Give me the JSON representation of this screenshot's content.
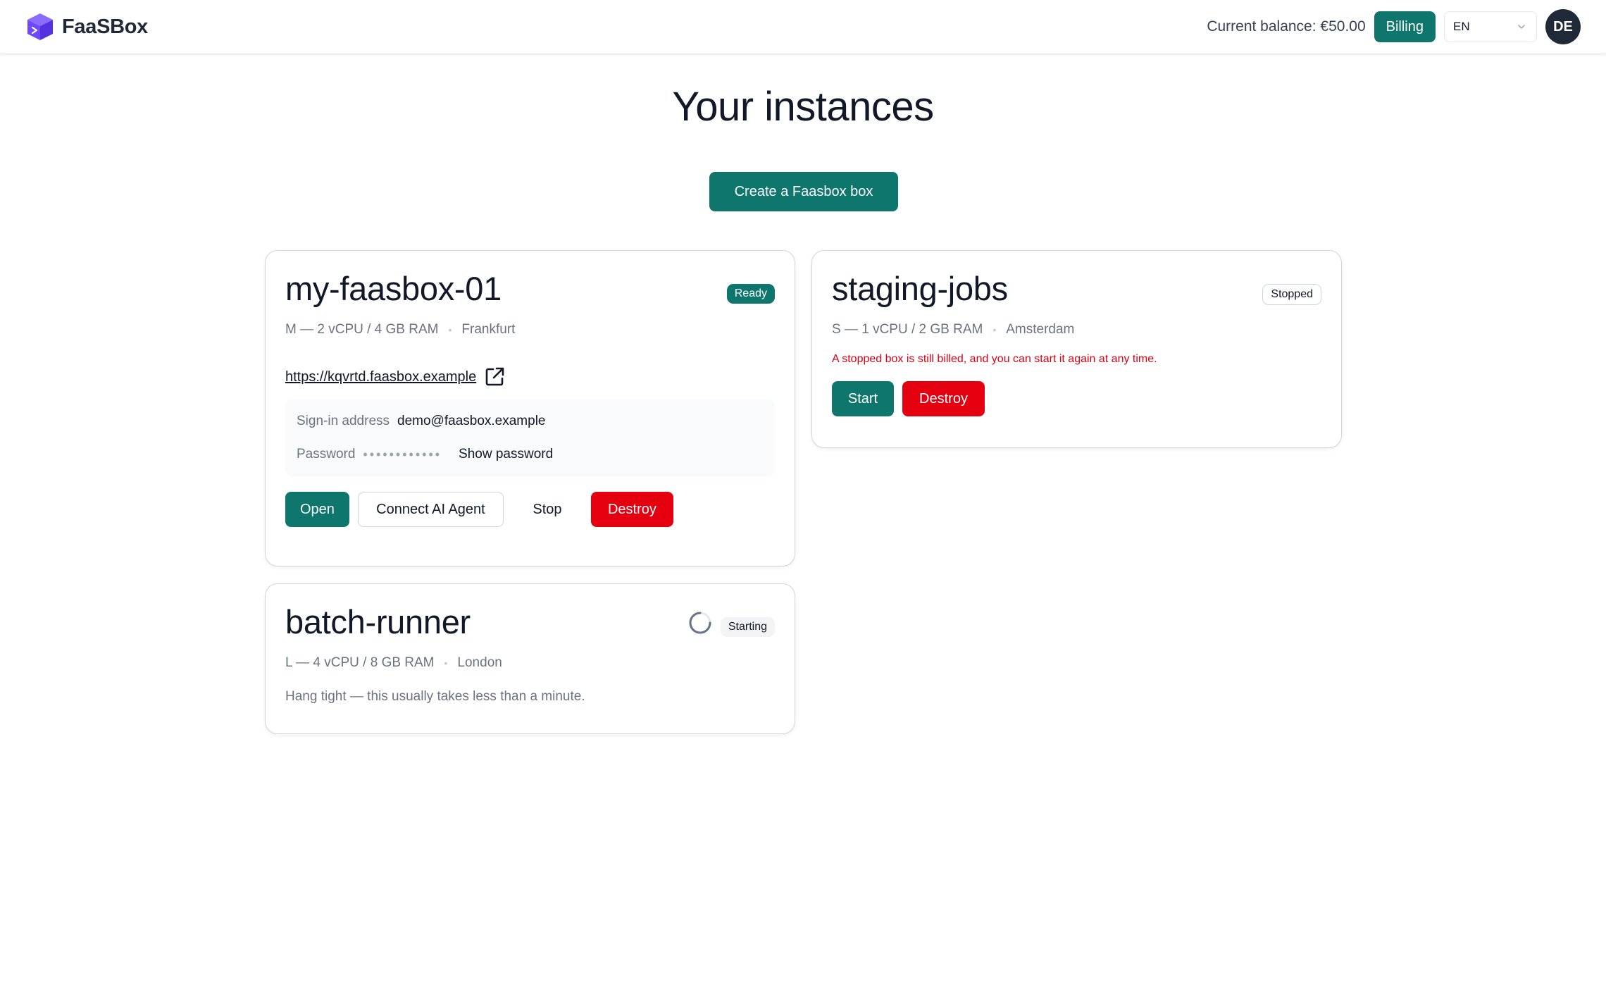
{
  "brand": {
    "name": "FaaSBox",
    "color": "#6d4aff"
  },
  "header": {
    "balance_text": "Current balance: €50.00",
    "billing_label": "Billing",
    "language": "EN",
    "avatar_initials": "DE"
  },
  "main": {
    "title": "Your instances",
    "create_label": "Create a Faasbox box"
  },
  "instances": [
    {
      "name": "my-faasbox-01",
      "status": "Ready",
      "size": "M — 2 vCPU / 4 GB RAM",
      "location": "Frankfurt",
      "url": "https://kqvrtd.faasbox.example",
      "signin_label": "Sign-in address",
      "signin_value": "demo@faasbox.example",
      "password_label": "Password",
      "password_mask": "••••••••••••",
      "show_password_label": "Show password",
      "actions": {
        "open": "Open",
        "connect": "Connect AI Agent",
        "stop": "Stop",
        "destroy": "Destroy"
      }
    },
    {
      "name": "staging-jobs",
      "status": "Stopped",
      "size": "S — 1 vCPU / 2 GB RAM",
      "location": "Amsterdam",
      "warning": "A stopped box is still billed, and you can start it again at any time.",
      "actions": {
        "start": "Start",
        "destroy": "Destroy"
      }
    },
    {
      "name": "batch-runner",
      "status": "Starting",
      "size": "L — 4 vCPU / 8 GB RAM",
      "location": "London",
      "hint": "Hang tight — this usually takes less than a minute."
    }
  ],
  "colors": {
    "accent": "#0f766e",
    "danger": "#e5000f",
    "warning_text": "#dc0010"
  },
  "icons": [
    "cube-logo-icon",
    "chevron-down-icon",
    "external-link-icon",
    "spinner-icon"
  ]
}
